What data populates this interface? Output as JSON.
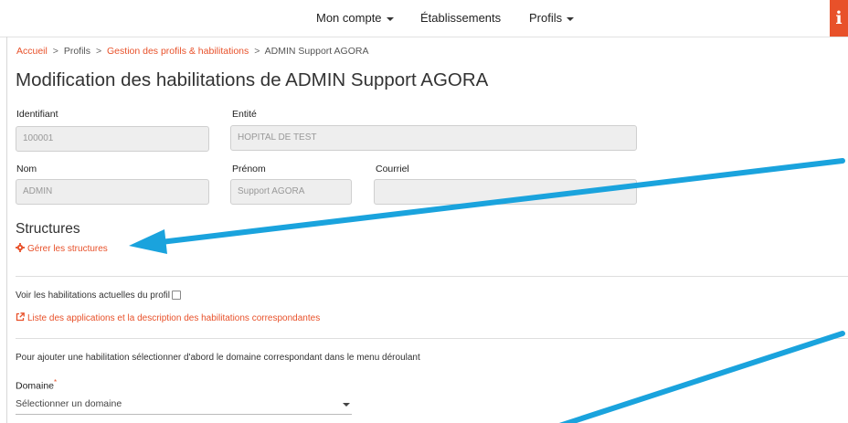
{
  "nav": {
    "items": [
      {
        "label": "Mon compte",
        "dropdown": true
      },
      {
        "label": "Établissements",
        "dropdown": false
      },
      {
        "label": "Profils",
        "dropdown": true
      }
    ],
    "info_icon": "info-icon",
    "accent": "#e8512a"
  },
  "breadcrumb": {
    "items": [
      "Accueil",
      "Profils",
      "Gestion des profils & habilitations",
      "ADMIN Support AGORA"
    ],
    "separator": ">"
  },
  "title": "Modification des habilitations de ADMIN Support AGORA",
  "fields": {
    "identifiant": {
      "label": "Identifiant",
      "value": "100001"
    },
    "entite": {
      "label": "Entité",
      "value": "HOPITAL DE TEST"
    },
    "nom": {
      "label": "Nom",
      "value": "ADMIN"
    },
    "prenom": {
      "label": "Prénom",
      "value": "Support AGORA"
    },
    "courriel": {
      "label": "Courriel",
      "value": ""
    }
  },
  "structures": {
    "title": "Structures",
    "manage_link": "Gérer les structures",
    "manage_icon": "gear-icon"
  },
  "habilitations": {
    "show_current_label": "Voir les habilitations actuelles du profil",
    "show_current_checked": false,
    "list_link": "Liste des applications et la description des habilitations correspondantes",
    "list_icon": "external-link-icon",
    "instruction": "Pour ajouter une habilitation sélectionner d'abord le domaine correspondant dans le menu déroulant"
  },
  "domaine": {
    "label": "Domaine",
    "required_mark": "*",
    "placeholder": "Sélectionner un domaine"
  },
  "annotations": {
    "arrow_color": "#1aa3dd"
  }
}
